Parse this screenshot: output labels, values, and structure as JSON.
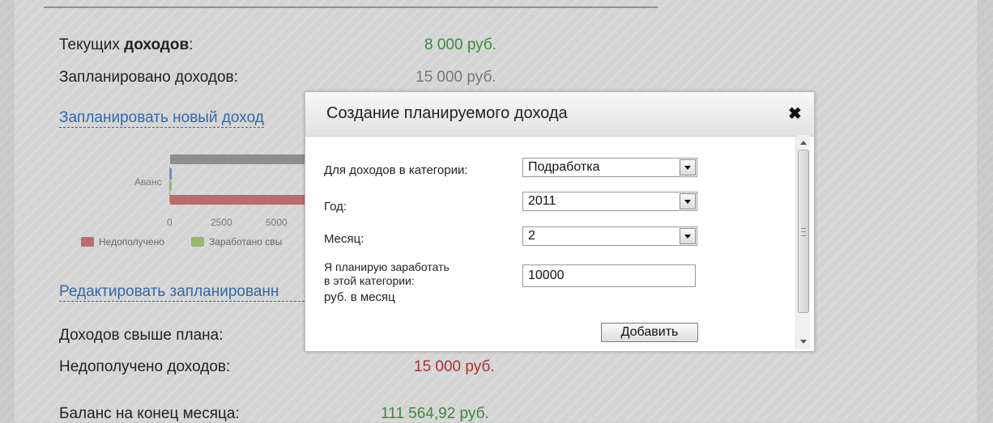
{
  "summary": {
    "current_income_prefix": "Текущих ",
    "current_income_bold": "доходов",
    "current_income_suffix": ":",
    "current_income_value": "8 000 руб.",
    "planned_income_label": "Запланировано доходов:",
    "planned_income_value": "15 000 руб.",
    "plan_new_link": "Запланировать новый доход",
    "edit_planned_link": "Редактировать запланированн",
    "over_plan_label": "Доходов свыше плана:",
    "not_received_label": "Недополучено доходов:",
    "not_received_value": "15 000 руб.",
    "balance_label": "Баланс на конец месяца:",
    "balance_value": "111 564,92 руб."
  },
  "chart_data": {
    "type": "bar",
    "categories": [
      "Аванс"
    ],
    "x_ticks": [
      "0",
      "2500",
      "5000"
    ],
    "legend": [
      "Недополучено",
      "Заработано свы"
    ]
  },
  "modal": {
    "title": "Создание планируемого дохода",
    "close_glyph": "✖",
    "category_label": "Для доходов в категории:",
    "category_value": "Подработка",
    "year_label": "Год:",
    "year_value": "2011",
    "month_label": "Месяц:",
    "month_value": "2",
    "amount_label_line1": "Я планирую заработать",
    "amount_label_line2": "в этой категории:",
    "amount_label_line3": "руб. в месяц",
    "amount_value": "10000",
    "add_button": "Добавить"
  },
  "colors": {
    "green_value": "#3b8a3b",
    "red_value": "#b03030",
    "link": "#2f6aa8",
    "legend_red": "#b86c6c",
    "legend_green": "#98b86a"
  },
  "icons": [
    "close-icon",
    "dropdown-arrow-icon",
    "scroll-up-icon",
    "scroll-down-icon"
  ]
}
